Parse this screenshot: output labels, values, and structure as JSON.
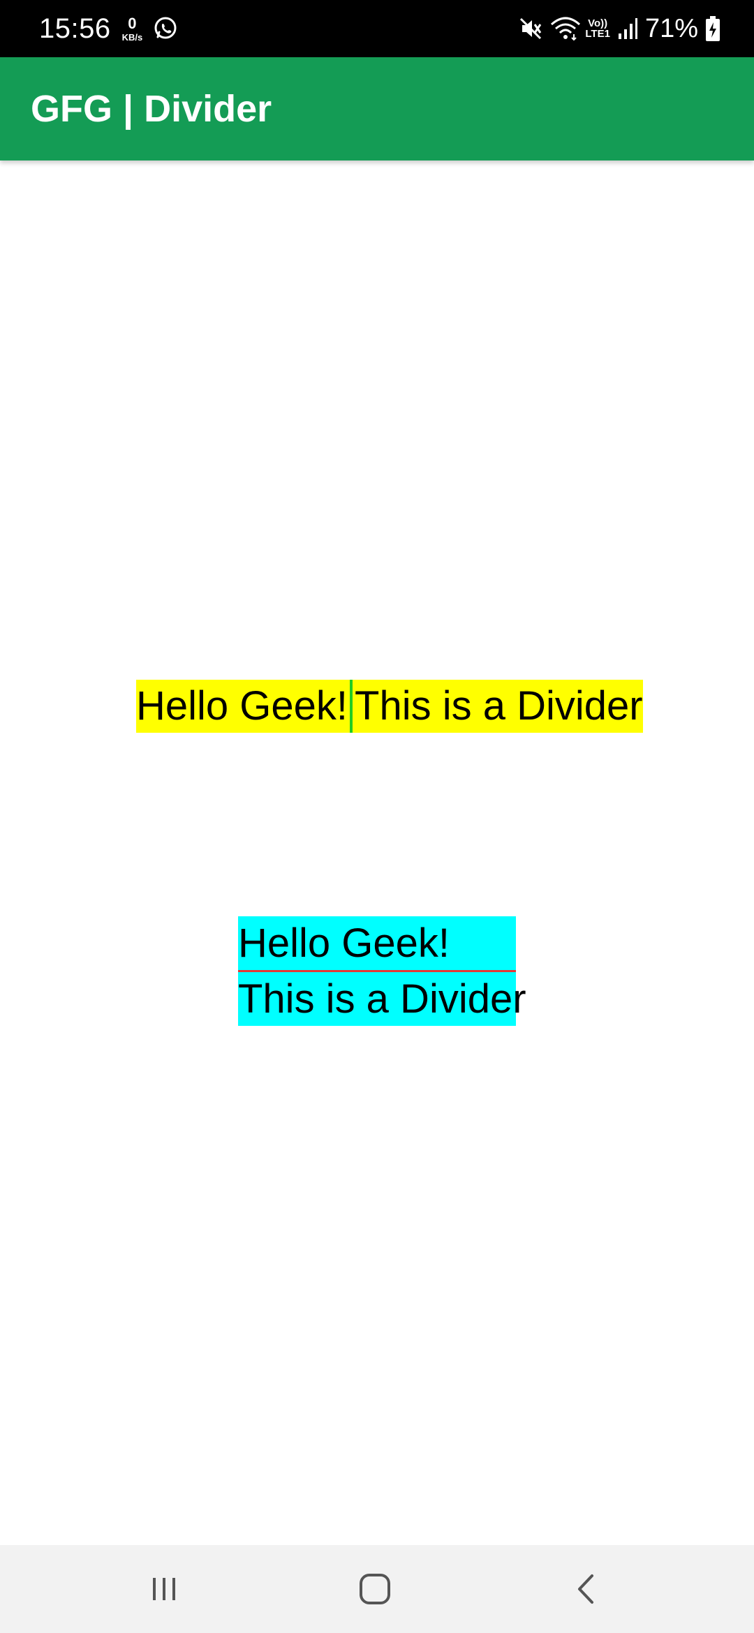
{
  "status_bar": {
    "time": "15:56",
    "net_speed_value": "0",
    "net_speed_unit": "KB/s",
    "lte_top": "Vo))",
    "lte_bottom": "LTE1",
    "battery": "71%",
    "icons": [
      "whatsapp-icon",
      "mute-icon",
      "wifi-icon",
      "signal-icon",
      "battery-charging-icon"
    ]
  },
  "app_bar": {
    "title": "GFG | Divider",
    "color": "#149c55"
  },
  "row_section": {
    "left_text": "Hello Geek!",
    "right_text": "This is a Divider",
    "background": "#ffff00",
    "divider_color": "#22cc22"
  },
  "column_section": {
    "top_text": "Hello Geek!",
    "bottom_text": "This is a Divider",
    "background": "#00ffff",
    "divider_color": "#e53935"
  },
  "nav_bar": {
    "icons": [
      "recent-apps-icon",
      "home-icon",
      "back-icon"
    ]
  }
}
